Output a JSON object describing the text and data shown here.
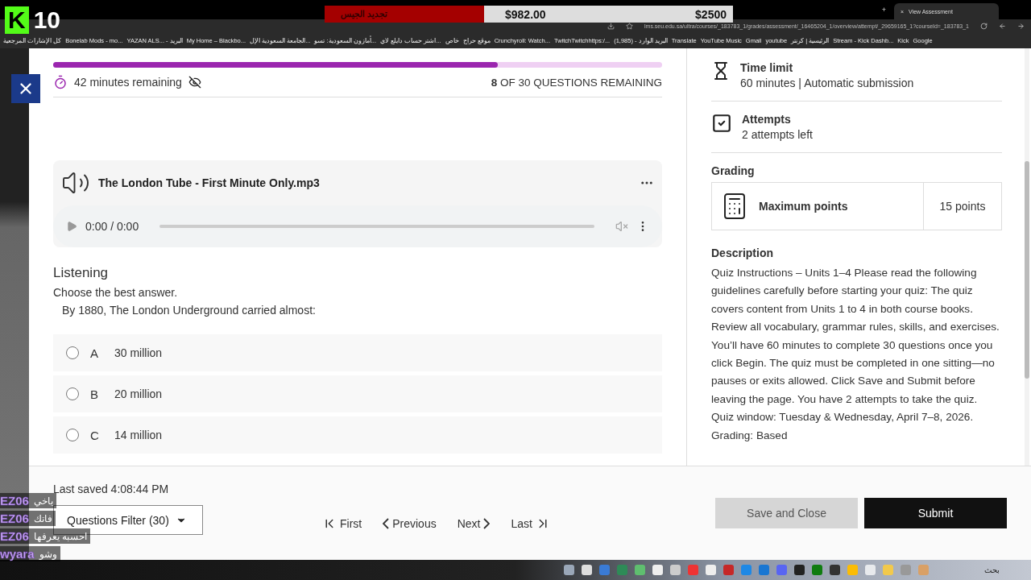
{
  "stream_overlay": {
    "logo": "K",
    "count": "10",
    "goal": {
      "label": "تجديد الجيس",
      "raised": "$982.00",
      "target": "$2500",
      "level": 0.39
    }
  },
  "browser": {
    "tab": {
      "title": "View Assessment",
      "close": "×"
    },
    "new_tab": "+",
    "url": "lms.seu.edu.sa/ultra/courses/_183783_1/grades/assessment/_16465204_1/overview/attempt/_29659165_1?courseId=_183783_1",
    "bookmarks": [
      "كل الإشارات المرجعية",
      "Bonelab Mods - mo...",
      "YAZAN ALS... - البريد",
      "My Home – Blackbo...",
      "الجامعة السعودية الإل...",
      "أمازون السعودية: تسو...",
      "اشتر حساب دايلع لاي...",
      "خاص",
      "موقع حراج",
      "Crunchyroll: Watch...",
      "TwitchTwitchhttps:/...",
      "(1,985) - البريد الوارد",
      "Translate",
      "YouTube Music",
      "Gmail",
      "youtube",
      "الرئيسية | كرنتر",
      "Stream - Kick Dashb...",
      "Kick",
      "Google"
    ]
  },
  "assessment": {
    "progress": {
      "level": 0.73
    },
    "time_remaining": "42 minutes remaining",
    "questions_remaining": "**8** OF 30 QUESTIONS REMAINING",
    "audio": {
      "file": "The London Tube - First Minute Only.mp3",
      "time": "0:00 / 0:00"
    },
    "section": "Listening",
    "instruction": "Choose the best answer.",
    "question": "By 1880, The London Underground carried almost:",
    "options": [
      {
        "letter": "A",
        "text": "30 million",
        "selected": false
      },
      {
        "letter": "B",
        "text": "20 million",
        "selected": false
      },
      {
        "letter": "C",
        "text": "14 million",
        "selected": false
      }
    ]
  },
  "details": {
    "time_limit": {
      "title": "Time limit",
      "value": "60 minutes | Automatic submission"
    },
    "attempts": {
      "title": "Attempts",
      "value": "2 attempts left"
    },
    "grading": {
      "title": "Grading",
      "label": "Maximum points",
      "points": "15 points"
    },
    "description": {
      "title": "Description",
      "text": "Quiz Instructions – Units 1–4 Please read the following guidelines carefully before starting your quiz: The quiz covers content from Units 1 to 4 in both course books. Review all vocabulary, grammar rules, skills, and exercises. You’ll have 60 minutes to complete 30 questions once you click Begin. The quiz must be completed in one sitting—no pauses or exits allowed. Click Save and Submit before leaving the page. You have 2 attempts to take the quiz. Quiz window: Tuesday & Wednesday, April 7–8, 2026. Grading: Based"
    }
  },
  "footer": {
    "last_saved": "Last saved 4:08:44 PM",
    "filter": "Questions Filter (30)",
    "nav": [
      "First",
      "Previous",
      "Next",
      "Last"
    ],
    "buttons": [
      {
        "label": "Save and Close",
        "disabled": true
      },
      {
        "label": "Submit",
        "disabled": false
      }
    ]
  },
  "chat": [
    {
      "user": "EZ06",
      "message": "ياخي"
    },
    {
      "user": "EZ06",
      "message": "فاتك"
    },
    {
      "user": "EZ06",
      "message": "احسبه يعرفها"
    },
    {
      "user": "wyara",
      "message": "وشو"
    }
  ],
  "taskbar": {
    "search": "بحث"
  }
}
